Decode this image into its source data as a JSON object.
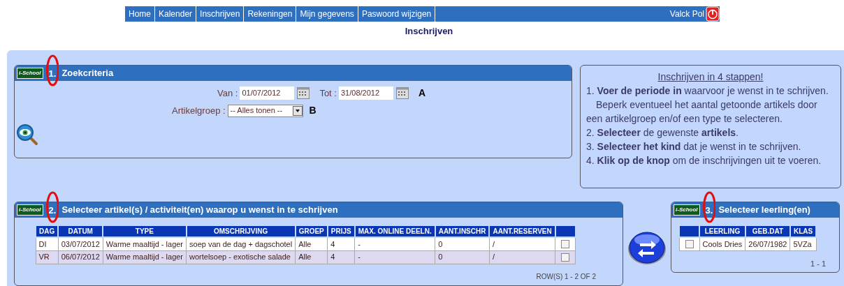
{
  "nav": {
    "items": [
      "Home",
      "Kalender",
      "Inschrijven",
      "Rekeningen",
      "Mijn gegevens",
      "Paswoord wijzigen"
    ],
    "user": "Valck Pol"
  },
  "page_title": "Inschrijven",
  "search_panel": {
    "logo": "i-School",
    "number": "1.",
    "title": "Zoekcriteria",
    "van_label": "Van :",
    "van_value": "01/07/2012",
    "tot_label": "Tot :",
    "tot_value": "31/08/2012",
    "marker_a": "A",
    "group_label": "Artikelgroep :",
    "group_value": "-- Alles tonen --",
    "marker_b": "B"
  },
  "steps": {
    "title": "Inschrijven in 4 stappen!",
    "lines": [
      "1. **Voer de periode in** waarvoor je wenst in te schrijven.",
      "Beperk eventueel het aantal getoonde artikels door een artikelgroep en/of een type te selecteren.",
      "2. **Selecteer** de gewenste **artikels**.",
      "3. **Selecteer het kind** dat je wenst in te schrijven.",
      "4. **Klik op de knop** om de inschrijvingen uit te voeren."
    ]
  },
  "articles_panel": {
    "logo": "i-School",
    "number": "2.",
    "title": "Selecteer artikel(s) / activiteit(en) waarop u wenst in te schrijven",
    "columns": [
      "DAG",
      "DATUM",
      "TYPE",
      "OMSCHRIJVING",
      "GROEP",
      "PRIJS",
      "MAX. ONLINE DEELN.",
      "AANT.INSCHR",
      "AANT.RESERVEN"
    ],
    "rows": [
      {
        "cells": [
          "DI",
          "03/07/2012",
          "Warme maaltijd - lager",
          "soep van de dag + dagschotel",
          "Alle",
          "4",
          "-",
          "0",
          "/"
        ],
        "checked": false
      },
      {
        "cells": [
          "VR",
          "06/07/2012",
          "Warme maaltijd - lager",
          "wortelsoep - exotische salade",
          "Alle",
          "4",
          "-",
          "0",
          "/"
        ],
        "checked": false
      }
    ],
    "pager": "ROW(S) 1 - 2 OF 2"
  },
  "students_panel": {
    "logo": "i-School",
    "number": "3.",
    "title": "Selecteer leerling(en)",
    "columns": [
      "LEERLING",
      "GEB.DAT",
      "KLAS"
    ],
    "rows": [
      {
        "cells": [
          "Cools Dries",
          "26/07/1982",
          "5VZa"
        ],
        "checked": false
      }
    ],
    "pager": "1 - 1"
  }
}
